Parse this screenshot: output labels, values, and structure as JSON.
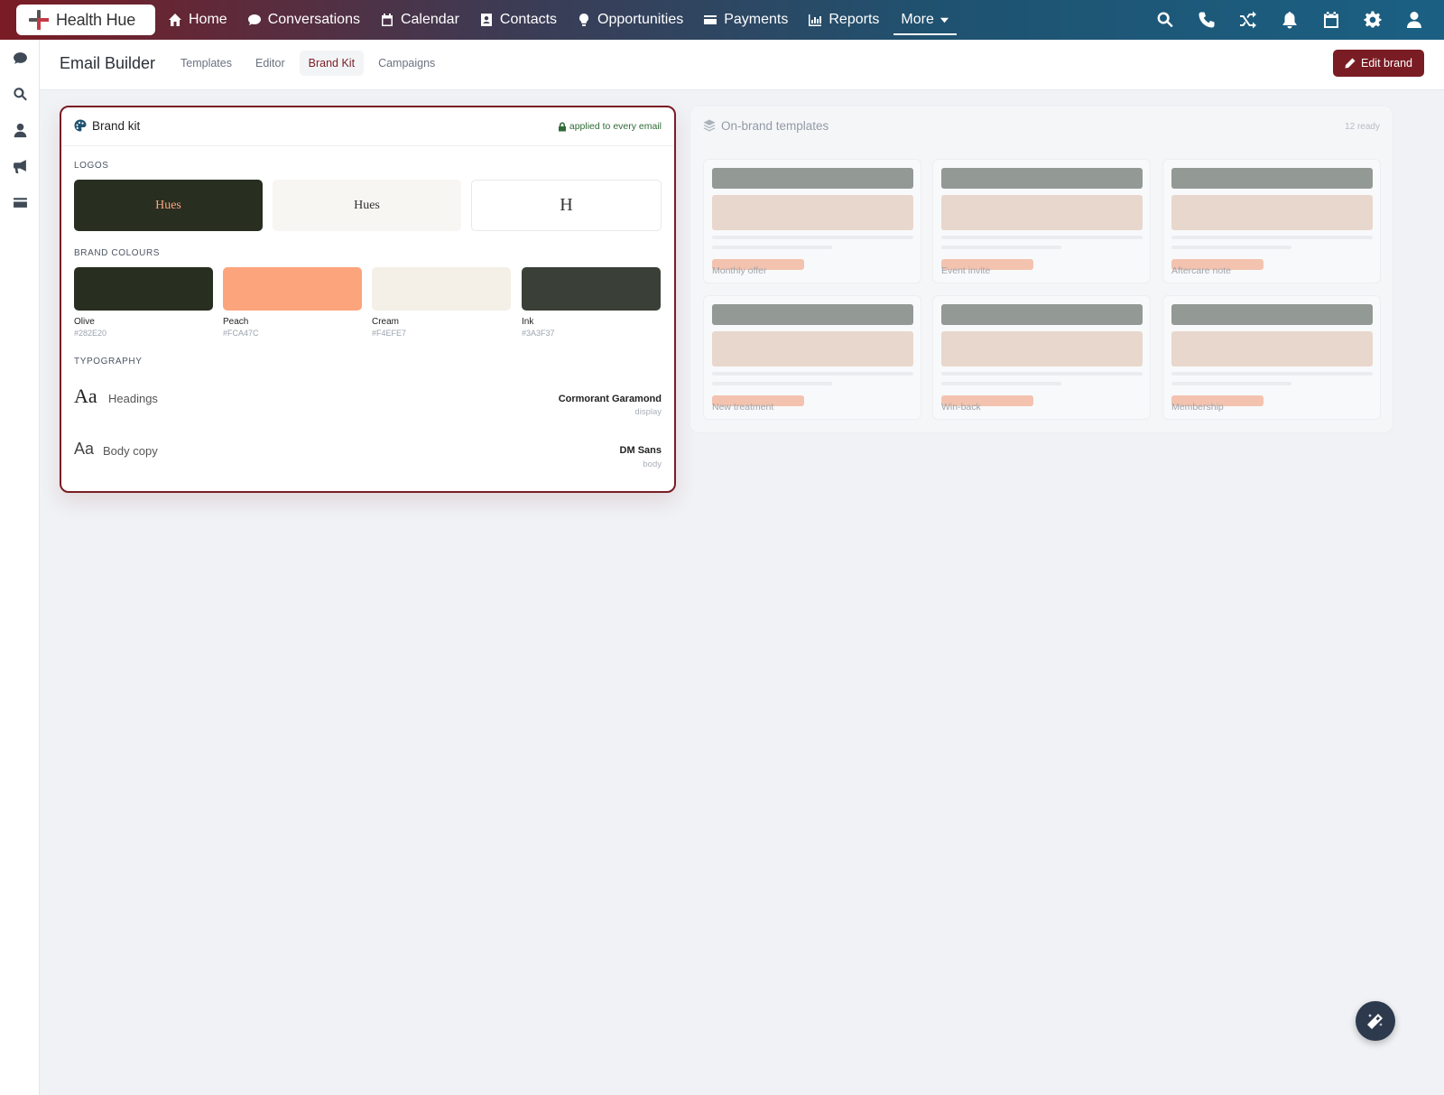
{
  "app": {
    "name": "Health Hue"
  },
  "nav": {
    "items": [
      {
        "label": "Home",
        "icon": "home-icon"
      },
      {
        "label": "Conversations",
        "icon": "chat-icon"
      },
      {
        "label": "Calendar",
        "icon": "calendar-icon"
      },
      {
        "label": "Contacts",
        "icon": "contacts-icon"
      },
      {
        "label": "Opportunities",
        "icon": "lightbulb-icon"
      },
      {
        "label": "Payments",
        "icon": "credit-card-icon"
      },
      {
        "label": "Reports",
        "icon": "bar-chart-icon"
      }
    ],
    "more_label": "More",
    "right_icons": [
      "search-icon",
      "phone-icon",
      "shuffle-icon",
      "bell-icon",
      "calendar-icon",
      "gear-icon",
      "user-icon"
    ]
  },
  "rail": {
    "icons": [
      "chat-icon",
      "search-icon",
      "user-icon",
      "megaphone-icon",
      "credit-card-icon"
    ]
  },
  "header": {
    "title": "Email Builder",
    "tabs": [
      {
        "label": "Templates",
        "active": false
      },
      {
        "label": "Editor",
        "active": false
      },
      {
        "label": "Brand Kit",
        "active": true
      },
      {
        "label": "Campaigns",
        "active": false
      }
    ],
    "edit_button": "Edit brand"
  },
  "brand_kit": {
    "title": "Brand kit",
    "applied_note": "applied to every email",
    "logos_label": "LOGOS",
    "logos": [
      {
        "text": "Hues",
        "background": "#282E20",
        "color": "#FCA47C"
      },
      {
        "text": "Hues",
        "background": "#F7F6F3",
        "color": "#333333"
      },
      {
        "text": "H",
        "background": "#FFFFFF",
        "color": "#333333"
      }
    ],
    "colours_label": "BRAND COLOURS",
    "colours": [
      {
        "name": "Olive",
        "hex": "#282E20"
      },
      {
        "name": "Peach",
        "hex": "#FCA47C"
      },
      {
        "name": "Cream",
        "hex": "#F4EFE7"
      },
      {
        "name": "Ink",
        "hex": "#3A3F37"
      }
    ],
    "typography_label": "TYPOGRAPHY",
    "typography": [
      {
        "sample": "Aa",
        "role": "Headings",
        "font": "Cormorant Garamond",
        "kind": "display"
      },
      {
        "sample": "Aa",
        "role": "Body copy",
        "font": "DM Sans",
        "kind": "body"
      }
    ]
  },
  "templates": {
    "title": "On-brand templates",
    "count": "12 ready",
    "items": [
      "Monthly offer",
      "Event invite",
      "Aftercare note",
      "New treatment",
      "Win-back",
      "Membership"
    ]
  },
  "colors": {
    "accent": "#7A1C24",
    "nav_blue": "#1B6083"
  }
}
